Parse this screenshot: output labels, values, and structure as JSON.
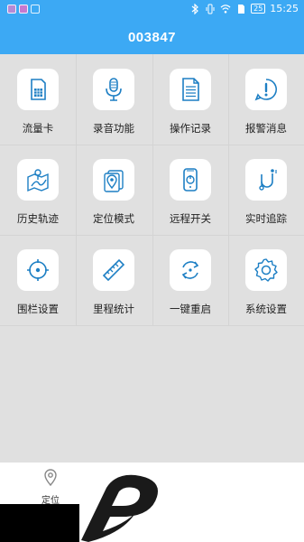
{
  "status_bar": {
    "time": "15:25",
    "battery": "25",
    "icons": [
      "app-icon-1",
      "app-icon-2",
      "app-icon-3",
      "bluetooth-icon",
      "vibrate-icon",
      "wifi-icon",
      "sim-icon",
      "battery-icon"
    ]
  },
  "header": {
    "title": "003847"
  },
  "grid": {
    "items": [
      {
        "label": "流量卡",
        "icon": "sim-card-icon"
      },
      {
        "label": "录音功能",
        "icon": "microphone-icon"
      },
      {
        "label": "操作记录",
        "icon": "document-icon"
      },
      {
        "label": "报警消息",
        "icon": "alert-icon"
      },
      {
        "label": "历史轨迹",
        "icon": "route-icon"
      },
      {
        "label": "定位模式",
        "icon": "location-mode-icon"
      },
      {
        "label": "远程开关",
        "icon": "remote-switch-icon"
      },
      {
        "label": "实时追踪",
        "icon": "tracking-icon"
      },
      {
        "label": "围栏设置",
        "icon": "fence-icon"
      },
      {
        "label": "里程统计",
        "icon": "ruler-icon"
      },
      {
        "label": "一键重启",
        "icon": "restart-icon"
      },
      {
        "label": "系统设置",
        "icon": "settings-icon"
      }
    ]
  },
  "bottom_nav": {
    "items": [
      {
        "label": "定位",
        "icon": "location-pin-icon"
      }
    ]
  },
  "colors": {
    "accent": "#3ca9f4",
    "icon_stroke": "#1d7fc4",
    "grid_bg": "#e0e0e0"
  }
}
